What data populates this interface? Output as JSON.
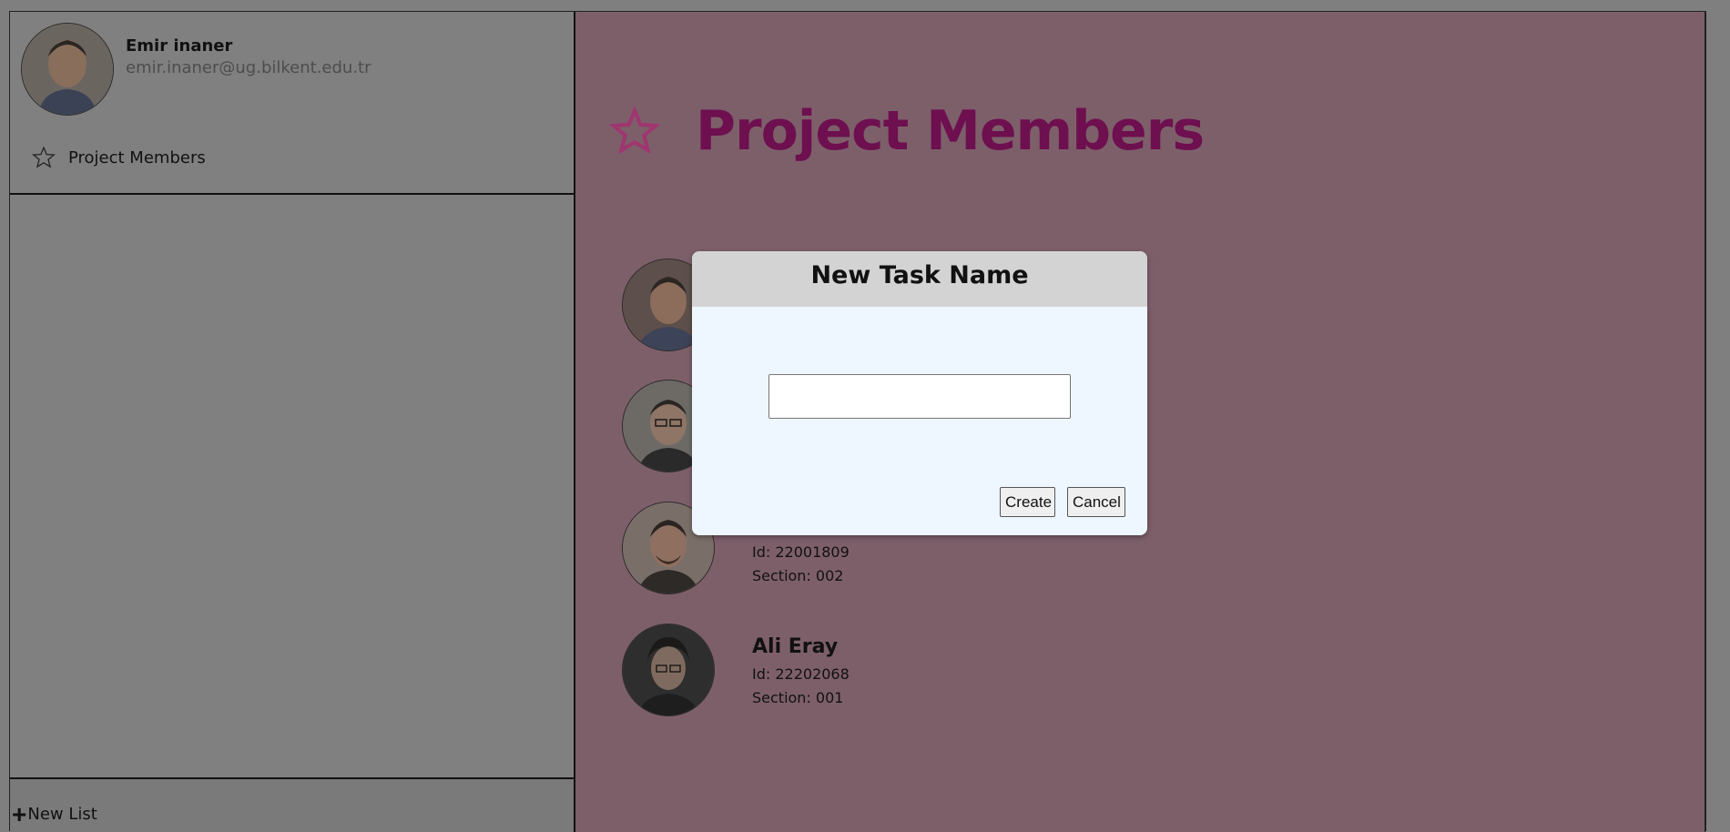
{
  "profile": {
    "name": "Emir inaner",
    "email": "emir.inaner@ug.bilkent.edu.tr",
    "avatar_icon": "user-photo"
  },
  "sidebar": {
    "items": [
      {
        "label": "Project Members",
        "icon": "star-outline-icon"
      }
    ],
    "new_list_label": "New List",
    "new_list_icon": "plus-icon"
  },
  "main": {
    "title": "Project Members",
    "title_icon": "star-outline-icon",
    "title_color": "#6e0f4f",
    "background_color": "#7d5f6a",
    "members": [
      {
        "name": "",
        "id_text": "",
        "section_text": ""
      },
      {
        "name": "",
        "id_text": "",
        "section_text": ""
      },
      {
        "name": "",
        "id_text": "Id: 22001809",
        "section_text": "Section: 002"
      },
      {
        "name": "Ali Eray",
        "id_text": "Id: 22202068",
        "section_text": "Section: 001"
      }
    ]
  },
  "dialog": {
    "title": "New Task Name",
    "input_value": "",
    "create_label": "Create",
    "cancel_label": "Cancel",
    "header_color": "#d3d3d3",
    "body_color": "#eef6ff"
  },
  "overlay_color": "#7f7f7f"
}
